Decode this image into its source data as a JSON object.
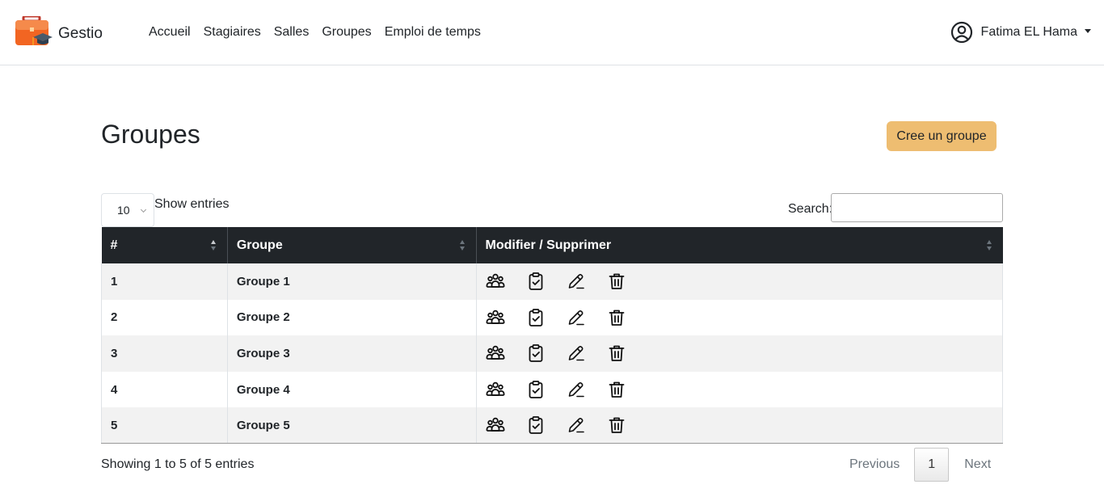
{
  "navbar": {
    "brand": "Gestio",
    "links": [
      "Accueil",
      "Stagiaires",
      "Salles",
      "Groupes",
      "Emploi de temps"
    ],
    "user_name": "Fatima EL Hama"
  },
  "page": {
    "title": "Groupes",
    "create_button": "Cree un groupe"
  },
  "controls": {
    "length_value": "10",
    "show_entries": "Show entries",
    "search_label": "Search:",
    "search_value": ""
  },
  "table": {
    "headers": [
      "#",
      "Groupe",
      "Modifier / Supprimer"
    ],
    "rows": [
      {
        "num": "1",
        "groupe": "Groupe 1"
      },
      {
        "num": "2",
        "groupe": "Groupe 2"
      },
      {
        "num": "3",
        "groupe": "Groupe 3"
      },
      {
        "num": "4",
        "groupe": "Groupe 4"
      },
      {
        "num": "5",
        "groupe": "Groupe 5"
      }
    ],
    "row_action_icons": [
      "people-icon",
      "clipboard-check-icon",
      "pencil-icon",
      "trash-icon"
    ]
  },
  "footer": {
    "info": "Showing 1 to 5 of 5 entries",
    "previous": "Previous",
    "page": "1",
    "next": "Next"
  },
  "colors": {
    "accent_button": "#eebd71",
    "table_header": "#212529",
    "logo_orange": "#f26522"
  }
}
